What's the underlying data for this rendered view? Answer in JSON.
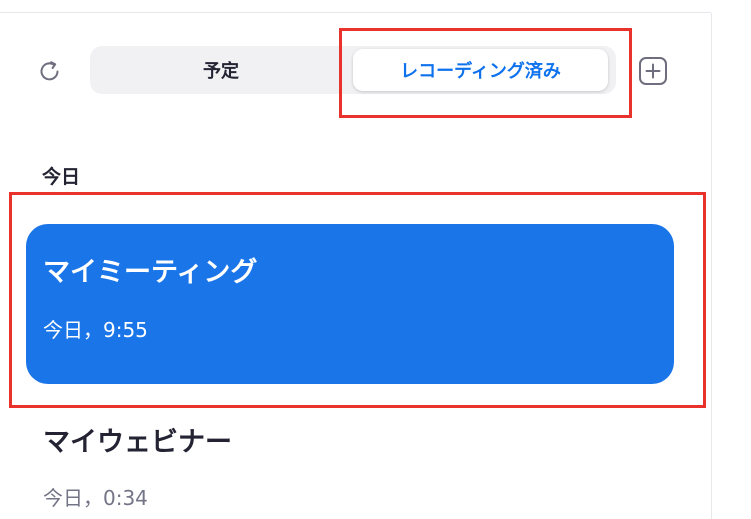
{
  "tabs": {
    "scheduled_label": "予定",
    "recorded_label": "レコーディング済み",
    "active": "recorded"
  },
  "icons": {
    "refresh": "refresh-icon",
    "add": "plus-square-icon"
  },
  "section": {
    "title": "今日"
  },
  "recordings": [
    {
      "title": "マイミーティング",
      "time": "今日，9:55",
      "selected": true
    },
    {
      "title": "マイウェビナー",
      "time": "今日，0:34",
      "selected": false
    }
  ],
  "colors": {
    "accent": "#0e72ed",
    "selected_card": "#1a75e8",
    "highlight_box": "#e8322b",
    "segment_bg": "#f1f1f4"
  }
}
